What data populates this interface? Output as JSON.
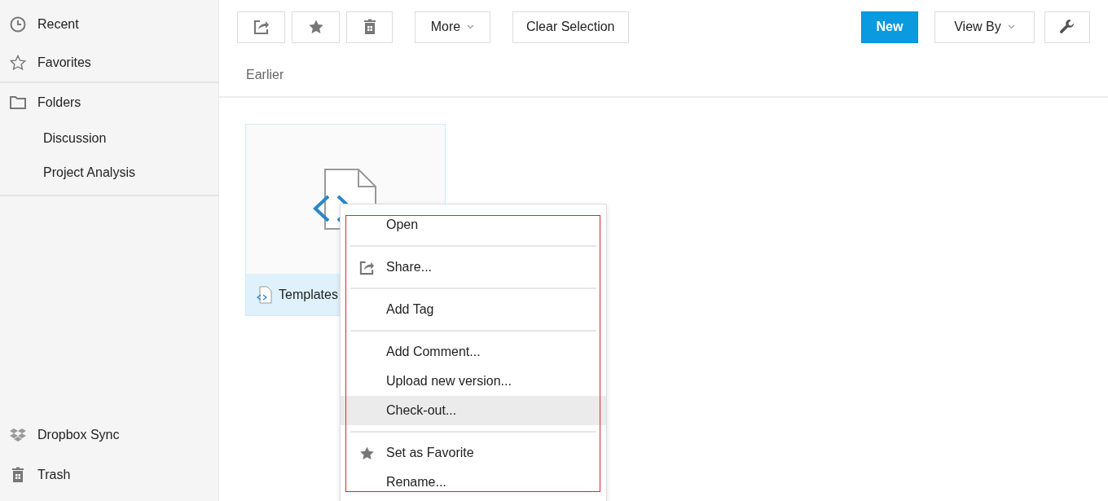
{
  "sidebar": {
    "items": [
      {
        "label": "Recent"
      },
      {
        "label": "Favorites"
      }
    ],
    "folders": {
      "label": "Folders",
      "children": [
        {
          "label": "Discussion"
        },
        {
          "label": "Project Analysis"
        }
      ]
    },
    "bottom_items": [
      {
        "label": "Dropbox Sync"
      },
      {
        "label": "Trash"
      }
    ]
  },
  "toolbar": {
    "more": "More",
    "clear": "Clear Selection",
    "new": "New",
    "view_by": "View By"
  },
  "section_heading": "Earlier",
  "file_card": {
    "name": "Templates"
  },
  "context_menu": {
    "groups": [
      [
        {
          "label": "Open",
          "kind": "plain",
          "selected": false
        }
      ],
      [
        {
          "label": "Share...",
          "kind": "share",
          "selected": false
        }
      ],
      [
        {
          "label": "Add Tag",
          "kind": "plain",
          "selected": false
        }
      ],
      [
        {
          "label": "Add Comment...",
          "kind": "plain",
          "selected": false
        },
        {
          "label": "Upload new version...",
          "kind": "plain",
          "selected": false
        },
        {
          "label": "Check-out...",
          "kind": "plain",
          "selected": true
        }
      ],
      [
        {
          "label": "Set as Favorite",
          "kind": "star",
          "selected": false
        },
        {
          "label": "Rename...",
          "kind": "plain",
          "selected": false
        }
      ]
    ]
  }
}
